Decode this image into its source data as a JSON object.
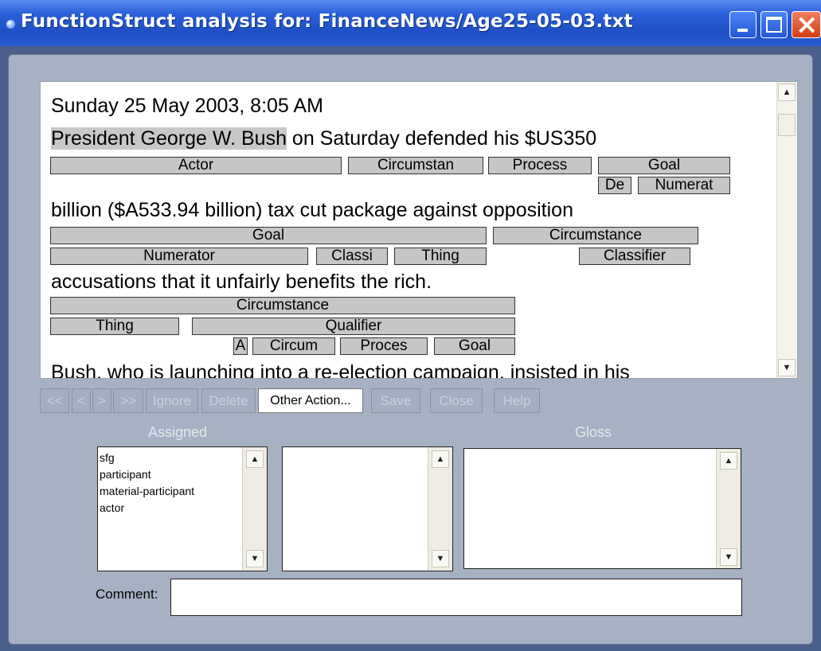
{
  "window": {
    "title": "FunctionStruct analysis for: FinanceNews/Age25-05-03.txt",
    "buttons": [
      "minimize",
      "maximize",
      "close"
    ]
  },
  "text_pane": {
    "date_line": "Sunday 25 May 2003, 8:05 AM",
    "line1": {
      "highlight": "President George W. Bush",
      "rest": " on Saturday defended his $US350"
    },
    "line1_boxes": [
      "Actor",
      "Circumstan",
      "Process",
      "Goal",
      "De",
      "Numerat"
    ],
    "line2": "billion ($A533.94 billion) tax cut package against opposition",
    "line2_boxes": [
      "Goal",
      "Circumstance",
      "Numerator",
      "Classi",
      "Thing",
      "Classifier"
    ],
    "line3": "accusations that it unfairly benefits the rich.",
    "line3_boxes": [
      "Circumstance",
      "Thing",
      "Qualifier",
      "A",
      "Circum",
      "Proces",
      "Goal"
    ],
    "line4": "Bush, who is launching into a re-election campaign, insisted in his"
  },
  "toolbar": {
    "first": "<<",
    "prev": "<",
    "next": ">",
    "last": ">>",
    "ignore": "Ignore",
    "delete": "Delete",
    "other_action": "Other Action...",
    "save": "Save",
    "close": "Close",
    "help": "Help"
  },
  "assigned": {
    "label": "Assigned",
    "items": [
      "sfg",
      "participant",
      "material-participant",
      "actor"
    ]
  },
  "gloss": {
    "label": "Gloss"
  },
  "comment": {
    "label": "Comment:",
    "value": ""
  }
}
